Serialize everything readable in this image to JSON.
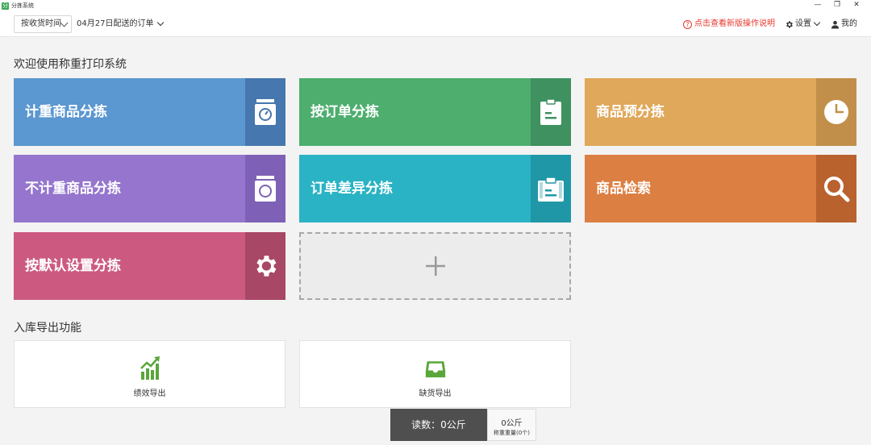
{
  "window": {
    "app_icon_glyph": "分",
    "title": "分拣系统",
    "controls": {
      "minimize": "—",
      "maximize": "❐",
      "close": "✕"
    }
  },
  "toolbar": {
    "time_select": {
      "value": "按收货时间"
    },
    "date_filter": {
      "label": "04月27日配送的订单"
    },
    "help": {
      "icon": "help-circle-icon",
      "label": "点击查看新版操作说明"
    },
    "settings": {
      "icon": "gear-icon",
      "label": "设置"
    },
    "mine": {
      "icon": "user-icon",
      "label": "我的"
    }
  },
  "welcome": {
    "title": "欢迎使用称重打印系统",
    "tiles": [
      {
        "label": "计重商品分拣",
        "icon": "scale-icon",
        "color": "#5b97d0",
        "icon_bg": "#4677ae"
      },
      {
        "label": "按订单分拣",
        "icon": "clipboard-icon",
        "color": "#4dae6e",
        "icon_bg": "#3f9160"
      },
      {
        "label": "商品预分拣",
        "icon": "clock-icon",
        "color": "#dfa85a",
        "icon_bg": "#c18f4a"
      },
      {
        "label": "不计重商品分拣",
        "icon": "scale-icon",
        "color": "#9575cd",
        "icon_bg": "#7e61b6"
      },
      {
        "label": "订单差异分拣",
        "icon": "clipboard-icon",
        "color": "#2ab3c4",
        "icon_bg": "#1f97a6"
      },
      {
        "label": "商品检索",
        "icon": "search-icon",
        "color": "#dc7f43",
        "icon_bg": "#b9622e"
      },
      {
        "label": "按默认设置分拣",
        "icon": "gear-icon",
        "color": "#cc5a80",
        "icon_bg": "#a84766"
      }
    ],
    "add_tile": {
      "icon": "plus-icon",
      "glyph": "+"
    }
  },
  "export": {
    "title": "入库导出功能",
    "items": [
      {
        "label": "绩效导出",
        "icon": "chart-up-icon",
        "color": "#5aa63a"
      },
      {
        "label": "缺货导出",
        "icon": "inbox-icon",
        "color": "#5aa63a"
      }
    ]
  },
  "status": {
    "reading": "读数：0公斤",
    "weight": "0公斤",
    "weight_sub": "称重重量(0个)"
  }
}
